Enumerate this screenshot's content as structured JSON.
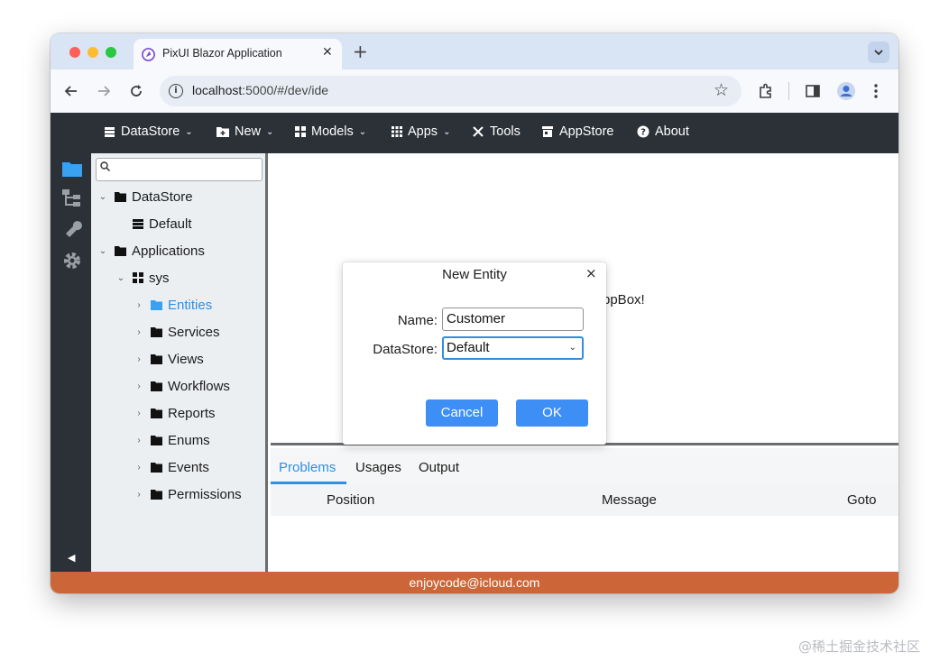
{
  "browser": {
    "tab_title": "PixUI Blazor Application",
    "tab_close": "✕",
    "new_tab": "+",
    "url_host": "localhost",
    "url_rest": ":5000/#/dev/ide"
  },
  "menu": [
    {
      "label": "DataStore",
      "icon": "database-icon",
      "has_dropdown": true
    },
    {
      "label": "New",
      "icon": "new-folder-icon",
      "has_dropdown": true
    },
    {
      "label": "Models",
      "icon": "models-icon",
      "has_dropdown": true
    },
    {
      "label": "Apps",
      "icon": "apps-grid-icon",
      "has_dropdown": true
    },
    {
      "label": "Tools",
      "icon": "tools-icon",
      "has_dropdown": false
    },
    {
      "label": "AppStore",
      "icon": "store-icon",
      "has_dropdown": false
    },
    {
      "label": "About",
      "icon": "help-icon",
      "has_dropdown": false
    }
  ],
  "sidebar_icons": [
    "folder-icon",
    "tree-icon",
    "wrench-icon",
    "gear-icon"
  ],
  "tree": {
    "search_placeholder": "",
    "nodes": [
      {
        "label": "DataStore",
        "expanded": true
      },
      {
        "label": "Default"
      },
      {
        "label": "Applications",
        "expanded": true
      },
      {
        "label": "sys",
        "expanded": true
      },
      {
        "label": "Entities",
        "selected": true
      },
      {
        "label": "Services"
      },
      {
        "label": "Views"
      },
      {
        "label": "Workflows"
      },
      {
        "label": "Reports"
      },
      {
        "label": "Enums"
      },
      {
        "label": "Events"
      },
      {
        "label": "Permissions"
      }
    ]
  },
  "content": {
    "welcome_text_visible": "ppBox!"
  },
  "bottom_panel": {
    "tabs": [
      "Problems",
      "Usages",
      "Output"
    ],
    "active_tab": "Problems",
    "columns": [
      "Position",
      "Message",
      "Goto"
    ]
  },
  "dialog": {
    "title": "New Entity",
    "close": "×",
    "name_label": "Name:",
    "name_value": "Customer",
    "datastore_label": "DataStore:",
    "datastore_value": "Default",
    "cancel_label": "Cancel",
    "ok_label": "OK"
  },
  "status": {
    "text": "enjoycode@icloud.com"
  },
  "watermark": "@稀土掘金技术社区",
  "colors": {
    "accent": "#2f8fe0",
    "button": "#3d8ff5",
    "header": "#2b3137",
    "statusbar": "#cc6638",
    "tab_strip": "#d9e4f5"
  }
}
